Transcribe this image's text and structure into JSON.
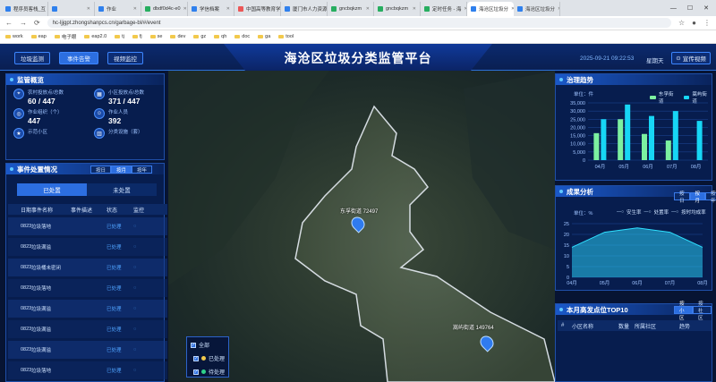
{
  "browser": {
    "tabs": [
      {
        "label": "程序员客栈_互",
        "color": "#2f80ed"
      },
      {
        "label": "",
        "color": "#2f80ed"
      },
      {
        "label": "作业",
        "color": "#2f80ed"
      },
      {
        "label": "dbdf0d4c-e0",
        "color": "#27ae60"
      },
      {
        "label": "学信档案",
        "color": "#2f80ed"
      },
      {
        "label": "中国高等教育学",
        "color": "#eb5757"
      },
      {
        "label": "厦门市人力资源",
        "color": "#2f80ed"
      },
      {
        "label": "gncbqkzm",
        "color": "#27ae60"
      },
      {
        "label": "gncbqkzm",
        "color": "#27ae60"
      },
      {
        "label": "定时任务 - 海",
        "color": "#27ae60"
      },
      {
        "label": "海沧区垃圾分",
        "color": "#2f80ed",
        "active": true
      },
      {
        "label": "海沧区垃圾分",
        "color": "#2f80ed"
      }
    ],
    "url": "hc-ljjgpt.zhongshanpcs.cn/garbage-bl/#/event",
    "bookmarks": [
      "work",
      "eap",
      "电子眼",
      "eap2.0",
      "tj",
      "fj",
      "se",
      "dev",
      "gz",
      "qh",
      "doc",
      "ga",
      "tool"
    ]
  },
  "header": {
    "title": "海沧区垃圾分类监管平台",
    "nav": [
      "垃圾监测",
      "事件告警",
      "视频监控"
    ],
    "active_nav": 1,
    "datetime": "2025-09-21 09:22:53",
    "weather": "星期天",
    "promo_button": "宣传视频"
  },
  "overview": {
    "title": "监管概览",
    "stats": [
      {
        "label": "农村投放点/总数",
        "value": "60 / 447",
        "icon": "location-icon"
      },
      {
        "label": "小区投放点/总数",
        "value": "371 / 447",
        "icon": "building-icon"
      },
      {
        "label": "作业组织（个）",
        "value": "447",
        "icon": "org-icon"
      },
      {
        "label": "作业人员",
        "value": "392",
        "icon": "person-icon"
      },
      {
        "label": "示范小区",
        "value": "",
        "icon": "star-icon"
      },
      {
        "label": "分类设施（套）",
        "value": "",
        "icon": "bin-icon"
      }
    ]
  },
  "events": {
    "title": "事件处置情况",
    "periods": [
      "按日",
      "按月",
      "按年"
    ],
    "active_period": 1,
    "tabs": [
      "已处置",
      "未处置"
    ],
    "active_tab": 0,
    "columns": [
      "日期",
      "事件名称",
      "事件描述",
      "状态",
      "监控"
    ],
    "rows": [
      {
        "date": "0823",
        "name": "垃圾落地",
        "status": "已处理"
      },
      {
        "date": "0823",
        "name": "垃圾满溢",
        "status": "已处理"
      },
      {
        "date": "0823",
        "name": "垃圾桶未密闭",
        "status": "已处理"
      },
      {
        "date": "0823",
        "name": "垃圾落地",
        "status": "已处理"
      },
      {
        "date": "0823",
        "name": "垃圾满溢",
        "status": "已处理"
      },
      {
        "date": "0823",
        "name": "垃圾满溢",
        "status": "已处理"
      },
      {
        "date": "0823",
        "name": "垃圾满溢",
        "status": "已处理"
      },
      {
        "date": "0823",
        "name": "垃圾落地",
        "status": "已处理"
      }
    ]
  },
  "map": {
    "markers": [
      {
        "label": "东孚街道 72497"
      },
      {
        "label": "嵩屿街道 149764"
      }
    ],
    "filter": {
      "all": "全部",
      "items": [
        {
          "label": "已处理",
          "color": "#f2c94c"
        },
        {
          "label": "待处理",
          "color": "#2fd18a"
        }
      ]
    }
  },
  "trend": {
    "title": "治理趋势",
    "unit": "单位：件",
    "colors": {
      "east": "#7cf0a0",
      "west": "#17d6f5"
    },
    "chart_data": {
      "type": "bar",
      "categories": [
        "04月",
        "05月",
        "06月",
        "07月",
        "08月"
      ],
      "series": [
        {
          "name": "东孚街道",
          "values": [
            16500,
            25000,
            16000,
            12000,
            0
          ]
        },
        {
          "name": "嵩屿街道",
          "values": [
            25000,
            34000,
            27000,
            30000,
            24000
          ]
        }
      ],
      "ylim": [
        0,
        35000
      ],
      "yticks": [
        "35,000",
        "30,000",
        "25,000",
        "20,000",
        "15,000",
        "10,000",
        "5,000",
        "0"
      ]
    }
  },
  "results": {
    "title": "成果分析",
    "periods": [
      "按日",
      "按月",
      "按年"
    ],
    "active_period": 1,
    "unit": "单位：%",
    "legend": [
      "安生率",
      "处置率",
      "按时均成率"
    ],
    "chart_data": {
      "type": "area",
      "categories": [
        "04月",
        "05月",
        "06月",
        "07月",
        "08月"
      ],
      "series": [
        {
          "name": "安生率",
          "values": [
            14,
            21,
            23,
            21,
            14
          ]
        }
      ],
      "ylim": [
        0,
        25
      ],
      "yticks": [
        "25",
        "20",
        "15",
        "10",
        "5",
        "0"
      ]
    }
  },
  "top10": {
    "title": "本月高发点位TOP10",
    "tabs": [
      "按小区",
      "按社区"
    ],
    "active_tab": 0,
    "columns": [
      "#",
      "小区名称",
      "数量",
      "所属社区",
      "趋势"
    ]
  }
}
